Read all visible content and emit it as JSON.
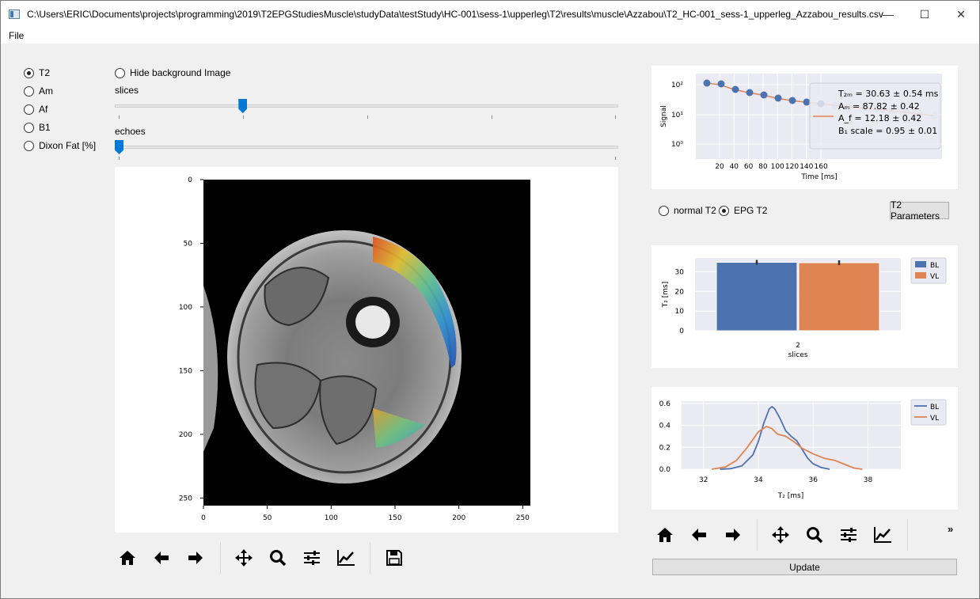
{
  "window": {
    "title": "C:\\Users\\ERIC\\Documents\\projects\\programming\\2019\\T2EPGStudiesMuscle\\studyData\\testStudy\\HC-001\\sess-1\\upperleg\\T2\\results\\muscle\\Azzabou\\T2_HC-001_sess-1_upperleg_Azzabou_results.csv",
    "minimize": "—",
    "maximize": "☐",
    "close": "✕"
  },
  "menu": {
    "file": "File"
  },
  "map_selector": {
    "options": [
      {
        "label": "T2",
        "checked": true
      },
      {
        "label": "Am",
        "checked": false
      },
      {
        "label": "Af",
        "checked": false
      },
      {
        "label": "B1",
        "checked": false
      },
      {
        "label": "Dixon Fat [%]",
        "checked": false
      }
    ]
  },
  "hide_background": {
    "label": "Hide background Image",
    "checked": false
  },
  "sliders": {
    "slices": {
      "label": "slices",
      "value_fraction": 0.25
    },
    "echoes": {
      "label": "echoes",
      "value_fraction": 0.0
    }
  },
  "image_plot": {
    "x_ticks": [
      "0",
      "50",
      "100",
      "150",
      "200",
      "250"
    ],
    "y_ticks": [
      "0",
      "50",
      "100",
      "150",
      "200",
      "250"
    ]
  },
  "decay_plot": {
    "ylabel": "Signal",
    "xlabel": "Time [ms]",
    "x_ticks": [
      "20",
      "40",
      "60",
      "80",
      "100",
      "120",
      "140",
      "160"
    ],
    "y_ticks": [
      "10⁰",
      "10¹",
      "10²"
    ],
    "legend": {
      "t2m": "T₂ₘ = 30.63 ± 0.54  ms",
      "am": "Aₘ = 87.82 ± 0.42",
      "af": "A_f = 12.18 ± 0.42",
      "b1": "B₁ scale = 0.95 ± 0.01"
    }
  },
  "fit_mode": {
    "normal": {
      "label": "normal T2",
      "checked": false
    },
    "epg": {
      "label": "EPG T2",
      "checked": true
    },
    "params_button": "T2 Parameters"
  },
  "chart_data": [
    {
      "type": "bar",
      "categories": [
        "2"
      ],
      "series": [
        {
          "name": "BL",
          "values": [
            34.8
          ],
          "color": "#4c72b0"
        },
        {
          "name": "VL",
          "values": [
            34.6
          ],
          "color": "#dd8452"
        }
      ],
      "xlabel": "slices",
      "ylabel": "T₂ [ms]",
      "y_ticks": [
        "0",
        "10",
        "20",
        "30"
      ],
      "ylim": [
        0,
        37
      ],
      "legend": "top-right",
      "grid": true
    },
    {
      "type": "line",
      "series": [
        {
          "name": "BL",
          "color": "#4c72b0",
          "x": [
            32.6,
            33.0,
            33.4,
            33.8,
            34.0,
            34.2,
            34.4,
            34.5,
            34.6,
            34.8,
            35.0,
            35.2,
            35.4,
            35.6,
            35.8,
            36.0,
            36.3,
            36.6
          ],
          "y": [
            0.0,
            0.005,
            0.03,
            0.13,
            0.25,
            0.42,
            0.55,
            0.57,
            0.55,
            0.46,
            0.35,
            0.3,
            0.26,
            0.18,
            0.1,
            0.05,
            0.015,
            0.0
          ]
        },
        {
          "name": "VL",
          "color": "#dd8452",
          "x": [
            32.3,
            32.8,
            33.2,
            33.6,
            34.0,
            34.3,
            34.5,
            34.7,
            35.0,
            35.3,
            35.6,
            36.0,
            36.4,
            36.8,
            37.2,
            37.5,
            37.8
          ],
          "y": [
            0.0,
            0.02,
            0.08,
            0.2,
            0.34,
            0.39,
            0.37,
            0.32,
            0.3,
            0.25,
            0.19,
            0.14,
            0.1,
            0.08,
            0.04,
            0.01,
            0.0
          ]
        }
      ],
      "xlabel": "T₂ [ms]",
      "x_ticks": [
        "32",
        "34",
        "36",
        "38"
      ],
      "y_ticks": [
        "0.0",
        "0.2",
        "0.4",
        "0.6"
      ],
      "xlim": [
        31.2,
        39.2
      ],
      "ylim": [
        0,
        0.62
      ],
      "legend": "top-right",
      "grid": true
    }
  ],
  "update_button": "Update",
  "overflow": "»"
}
